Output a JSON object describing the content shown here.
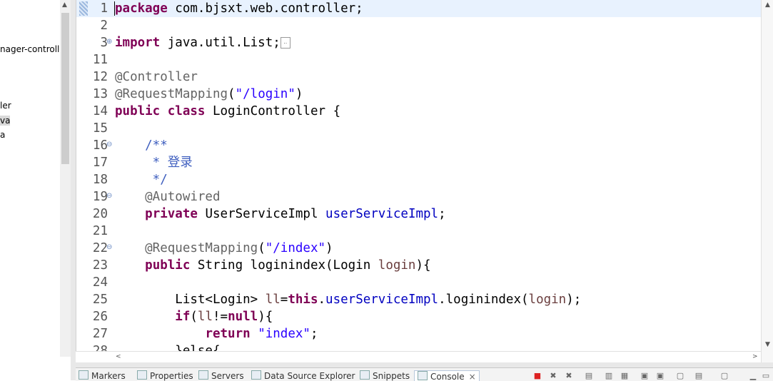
{
  "explorer": {
    "items": [
      {
        "label": "nager-controlle"
      },
      {
        "label": "ler"
      },
      {
        "label": "va"
      },
      {
        "label": "a"
      }
    ]
  },
  "editor": {
    "lines": [
      {
        "num": "1",
        "tokens": [
          {
            "t": "package",
            "c": "kw"
          },
          {
            "t": " com.bjsxt.web.controller;",
            "c": ""
          }
        ]
      },
      {
        "num": "2",
        "tokens": []
      },
      {
        "num": "3",
        "tokens": [
          {
            "t": "import",
            "c": "kw"
          },
          {
            "t": " java.util.List;",
            "c": ""
          }
        ]
      },
      {
        "num": "11",
        "tokens": []
      },
      {
        "num": "12",
        "tokens": [
          {
            "t": "@Controller",
            "c": "ann"
          }
        ]
      },
      {
        "num": "13",
        "tokens": [
          {
            "t": "@RequestMapping",
            "c": "ann"
          },
          {
            "t": "(",
            "c": ""
          },
          {
            "t": "\"/login\"",
            "c": "str"
          },
          {
            "t": ")",
            "c": ""
          }
        ]
      },
      {
        "num": "14",
        "tokens": [
          {
            "t": "public",
            "c": "kw"
          },
          {
            "t": " ",
            "c": ""
          },
          {
            "t": "class",
            "c": "kw"
          },
          {
            "t": " LoginController {",
            "c": ""
          }
        ]
      },
      {
        "num": "15",
        "tokens": []
      },
      {
        "num": "16",
        "tokens": [
          {
            "t": "    /**",
            "c": "cmt"
          }
        ]
      },
      {
        "num": "17",
        "tokens": [
          {
            "t": "     * 登录",
            "c": "cmt"
          }
        ]
      },
      {
        "num": "18",
        "tokens": [
          {
            "t": "     */",
            "c": "cmt"
          }
        ]
      },
      {
        "num": "19",
        "tokens": [
          {
            "t": "    @Autowired",
            "c": "ann"
          }
        ]
      },
      {
        "num": "20",
        "tokens": [
          {
            "t": "    ",
            "c": ""
          },
          {
            "t": "private",
            "c": "kw"
          },
          {
            "t": " UserServiceImpl ",
            "c": ""
          },
          {
            "t": "userServiceImpl",
            "c": "fld"
          },
          {
            "t": ";",
            "c": ""
          }
        ]
      },
      {
        "num": "21",
        "tokens": []
      },
      {
        "num": "22",
        "tokens": [
          {
            "t": "    @RequestMapping",
            "c": "ann"
          },
          {
            "t": "(",
            "c": ""
          },
          {
            "t": "\"/index\"",
            "c": "str"
          },
          {
            "t": ")",
            "c": ""
          }
        ]
      },
      {
        "num": "23",
        "tokens": [
          {
            "t": "    ",
            "c": ""
          },
          {
            "t": "public",
            "c": "kw"
          },
          {
            "t": " String loginindex(Login ",
            "c": ""
          },
          {
            "t": "login",
            "c": "prm"
          },
          {
            "t": "){",
            "c": ""
          }
        ]
      },
      {
        "num": "24",
        "tokens": []
      },
      {
        "num": "25",
        "tokens": [
          {
            "t": "        List<Login> ",
            "c": ""
          },
          {
            "t": "ll",
            "c": "prm"
          },
          {
            "t": "=",
            "c": ""
          },
          {
            "t": "this",
            "c": "kw"
          },
          {
            "t": ".",
            "c": ""
          },
          {
            "t": "userServiceImpl",
            "c": "fld"
          },
          {
            "t": ".loginindex(",
            "c": ""
          },
          {
            "t": "login",
            "c": "prm"
          },
          {
            "t": ");",
            "c": ""
          }
        ]
      },
      {
        "num": "26",
        "tokens": [
          {
            "t": "        ",
            "c": ""
          },
          {
            "t": "if",
            "c": "kw"
          },
          {
            "t": "(",
            "c": ""
          },
          {
            "t": "ll",
            "c": "prm"
          },
          {
            "t": "!=",
            "c": ""
          },
          {
            "t": "null",
            "c": "kw"
          },
          {
            "t": "){",
            "c": ""
          }
        ]
      },
      {
        "num": "27",
        "tokens": [
          {
            "t": "            ",
            "c": ""
          },
          {
            "t": "return",
            "c": "kw"
          },
          {
            "t": " ",
            "c": ""
          },
          {
            "t": "\"index\"",
            "c": "str"
          },
          {
            "t": ";",
            "c": ""
          }
        ]
      },
      {
        "num": "28",
        "tokens": [
          {
            "t": "        }else{",
            "c": ""
          }
        ]
      }
    ]
  },
  "bottom_tabs": [
    {
      "label": "Markers",
      "icon": "markers-icon"
    },
    {
      "label": "Properties",
      "icon": "properties-icon"
    },
    {
      "label": "Servers",
      "icon": "servers-icon"
    },
    {
      "label": "Data Source Explorer",
      "icon": "data-source-icon"
    },
    {
      "label": "Snippets",
      "icon": "snippets-icon"
    },
    {
      "label": "Console",
      "icon": "console-icon",
      "active": true
    }
  ],
  "console_close": "×"
}
